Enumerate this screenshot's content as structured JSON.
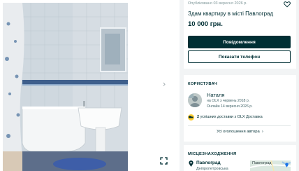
{
  "ad": {
    "published": "Опубліковано 03 вересня 2026 р.",
    "title": "Здам квартиру в місті Павлоград",
    "price": "10 000 грн.",
    "message_button": "Повідомлення",
    "phone_button": "Показати телефон"
  },
  "gallery": {
    "next_glyph": "›"
  },
  "user": {
    "section_title": "КОРИСТУВАЧ",
    "name": "Наталя",
    "since": "на OLX з червень 2018 р.",
    "online": "Онлайн 14 вересня 2026 р.",
    "deliveries_count": "2",
    "deliveries_text": " успішних доставки з OLX Доставка",
    "all_ads_link": "Усі оголошення автора",
    "all_ads_chevron": "›"
  },
  "location": {
    "section_title": "МІСЦЕЗНАХОДЖЕННЯ",
    "city": "Павлоград",
    "region": "Дніпропетровська",
    "map_label": "Павлоград"
  },
  "colors": {
    "brand_dark": "#002f34",
    "delivery_badge": "#ffce32"
  }
}
